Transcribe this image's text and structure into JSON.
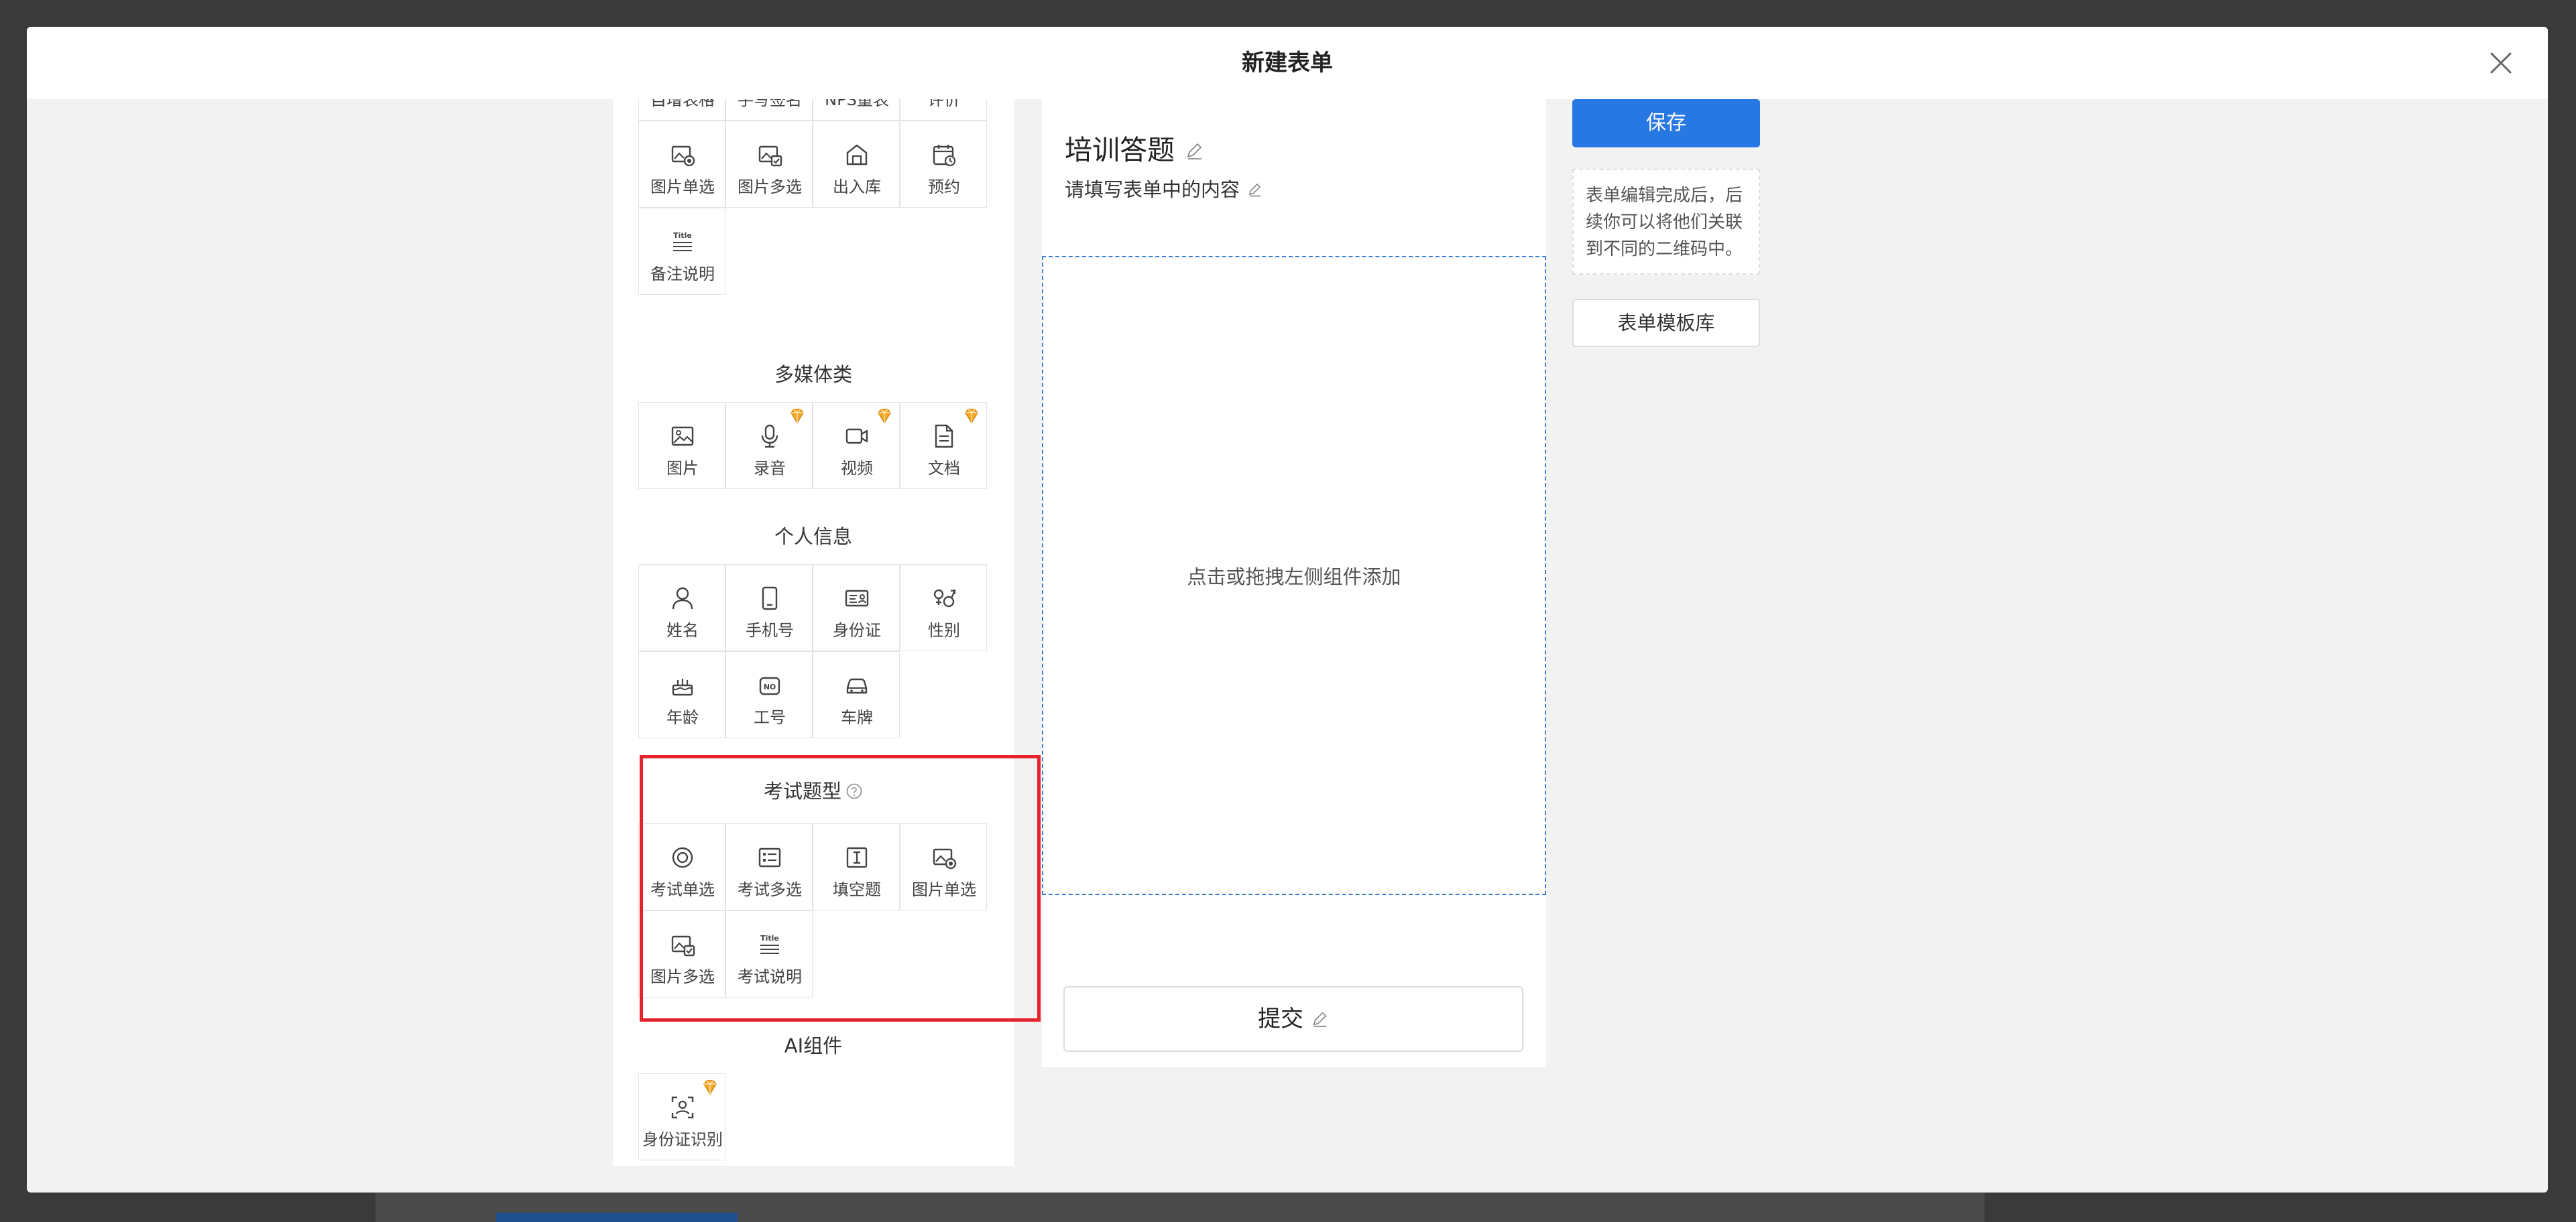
{
  "modal": {
    "title": "新建表单"
  },
  "palette": {
    "cut_row": {
      "items": [
        {
          "label": "自增表格",
          "icon": "table-icon"
        },
        {
          "label": "手写签名",
          "icon": "signature-icon"
        },
        {
          "label": "NPS量表",
          "icon": "nps-icon"
        },
        {
          "label": "评价",
          "icon": "rating-icon"
        }
      ]
    },
    "basic_rows": {
      "items": [
        {
          "label": "图片单选",
          "icon": "image-radio-icon"
        },
        {
          "label": "图片多选",
          "icon": "image-checkbox-icon"
        },
        {
          "label": "出入库",
          "icon": "warehouse-icon"
        },
        {
          "label": "预约",
          "icon": "calendar-clock-icon"
        },
        {
          "label": "备注说明",
          "icon": "title-note-icon"
        }
      ]
    },
    "media": {
      "title": "多媒体类",
      "items": [
        {
          "label": "图片",
          "icon": "image-icon",
          "premium": false
        },
        {
          "label": "录音",
          "icon": "microphone-icon",
          "premium": true
        },
        {
          "label": "视频",
          "icon": "video-icon",
          "premium": true
        },
        {
          "label": "文档",
          "icon": "document-icon",
          "premium": true
        }
      ]
    },
    "personal": {
      "title": "个人信息",
      "items": [
        {
          "label": "姓名",
          "icon": "person-icon"
        },
        {
          "label": "手机号",
          "icon": "phone-icon"
        },
        {
          "label": "身份证",
          "icon": "id-card-icon"
        },
        {
          "label": "性别",
          "icon": "gender-icon"
        },
        {
          "label": "年龄",
          "icon": "cake-icon"
        },
        {
          "label": "工号",
          "icon": "badge-number-icon"
        },
        {
          "label": "车牌",
          "icon": "car-icon"
        }
      ]
    },
    "exam": {
      "title": "考试题型",
      "items": [
        {
          "label": "考试单选",
          "icon": "radio-icon"
        },
        {
          "label": "考试多选",
          "icon": "checklist-icon"
        },
        {
          "label": "填空题",
          "icon": "text-cursor-icon"
        },
        {
          "label": "图片单选",
          "icon": "image-radio-icon"
        },
        {
          "label": "图片多选",
          "icon": "image-checkbox-icon"
        },
        {
          "label": "考试说明",
          "icon": "title-note-icon"
        }
      ]
    },
    "ai": {
      "title": "AI组件",
      "items": [
        {
          "label": "身份证识别",
          "icon": "face-scan-icon",
          "premium": true
        }
      ]
    }
  },
  "form": {
    "title": "培训答题",
    "description": "请填写表单中的内容",
    "drop_hint": "点击或拖拽左侧组件添加",
    "submit_label": "提交"
  },
  "actions": {
    "save_label": "保存",
    "tip": "表单编辑完成后，后续你可以将他们关联到不同的二维码中。",
    "template_label": "表单模板库"
  },
  "colors": {
    "primary": "#2878e4",
    "highlight": "#e6232c",
    "drop_border": "#3d7fd6",
    "premium": "#f5a623"
  }
}
